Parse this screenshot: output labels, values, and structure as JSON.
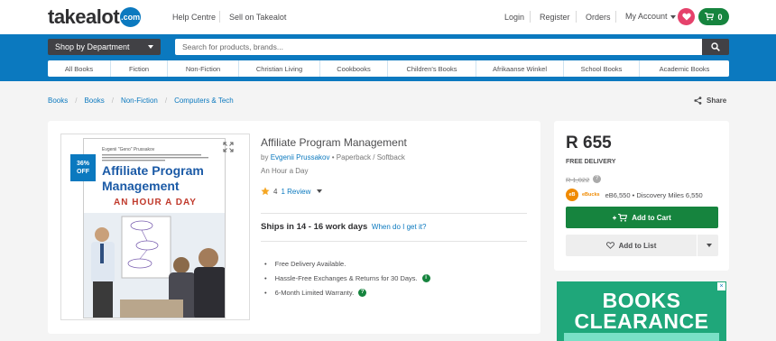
{
  "header": {
    "logo_text": "takealot",
    "logo_badge": ".com",
    "help_centre": "Help Centre",
    "sell_on": "Sell on Takealot",
    "login": "Login",
    "register": "Register",
    "orders": "Orders",
    "my_account": "My Account",
    "cart_count": "0"
  },
  "nav": {
    "shop_by_department": "Shop by Department",
    "search_placeholder": "Search for products, brands...",
    "categories": [
      "All Books",
      "Fiction",
      "Non-Fiction",
      "Christian Living",
      "Cookbooks",
      "Children's Books",
      "Afrikaanse Winkel",
      "School Books",
      "Academic Books"
    ]
  },
  "breadcrumb": [
    "Books",
    "Books",
    "Non-Fiction",
    "Computers & Tech"
  ],
  "share_label": "Share",
  "product": {
    "discount_line1": "36%",
    "discount_line2": "OFF",
    "cover": {
      "author": "Evgenii \"Geno\" Prussakov",
      "title_line1": "Affiliate Program",
      "title_line2": "Management",
      "tagline": "AN HOUR A DAY"
    },
    "title": "Affiliate Program Management",
    "by": "by",
    "author": "Evgenii Prussakov",
    "format": "Paperback / Softback",
    "subtitle": "An Hour a Day",
    "rating": "4",
    "reviews": "1 Review",
    "ships": "Ships in 14 - 16 work days",
    "when_link": "When do I get it?",
    "benefits": [
      "Free Delivery Available.",
      "Hassle-Free Exchanges & Returns for 30 Days.",
      "6-Month Limited Warranty."
    ]
  },
  "pricing": {
    "price": "R 655",
    "free_delivery": "FREE DELIVERY",
    "list_price": "R 1,022",
    "ebucks_word": "eBucks",
    "ebucks_text": "eB6,550 • Discovery Miles 6,550",
    "add_to_cart": "Add to Cart",
    "add_to_list": "Add to List"
  },
  "ad": {
    "line1": "BOOKS",
    "line2": "CLEARANCE"
  },
  "colors": {
    "brand_blue": "#0b79bf",
    "cart_green": "#16843e",
    "heart_pink": "#e5426b",
    "ad_green": "#1fa77a"
  }
}
